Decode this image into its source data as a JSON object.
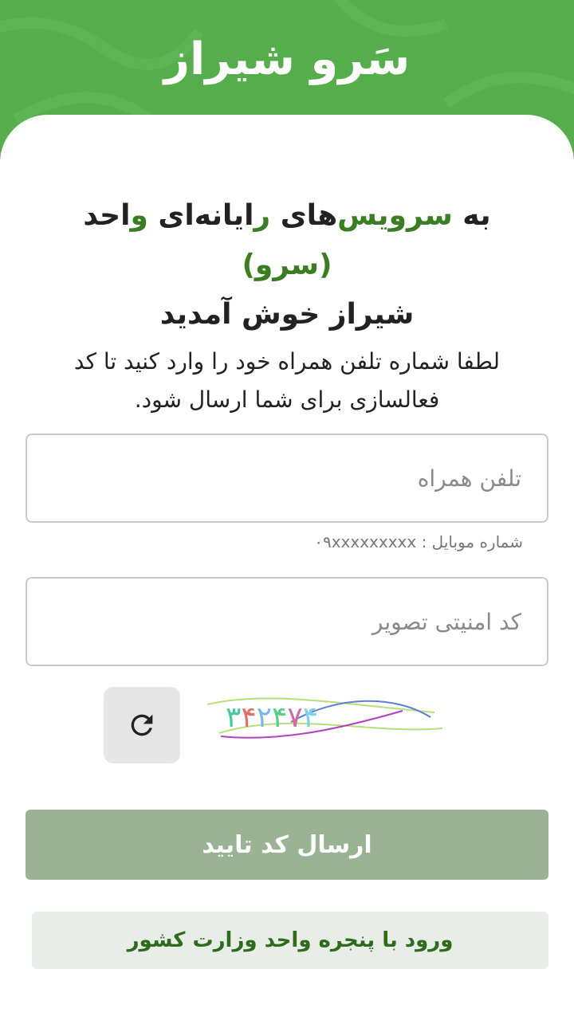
{
  "header": {
    "title": "سَرو شیراز"
  },
  "welcome": {
    "p1": "به ",
    "g1": "سرویس",
    "p2": "‌های ",
    "g2": "ر",
    "p3": "ایانه‌ای ",
    "g3": "و",
    "p4": "احد ",
    "g4": "(سرو)",
    "line2": "شیراز خوش آمدید"
  },
  "instruction": "لطفا شماره تلفن همراه خود را وارد کنید تا کد فعالسازی برای شما ارسال شود.",
  "phone": {
    "placeholder": "تلفن همراه",
    "value": "",
    "hint": "شماره موبایل : ۰۹xxxxxxxxx"
  },
  "captcha_field": {
    "placeholder": "کد امنیتی تصویر",
    "value": ""
  },
  "captcha": {
    "text": "۳۴۲۴۷۴"
  },
  "buttons": {
    "submit": "ارسال کد تایید",
    "alt_login": "ورود با پنجره واحد وزارت کشور"
  },
  "icons": {
    "refresh": "refresh-icon"
  },
  "colors": {
    "brand": "#55ad4b",
    "accent": "#3b7d22",
    "submit": "#99b394",
    "alt_bg": "#e8ede8"
  }
}
